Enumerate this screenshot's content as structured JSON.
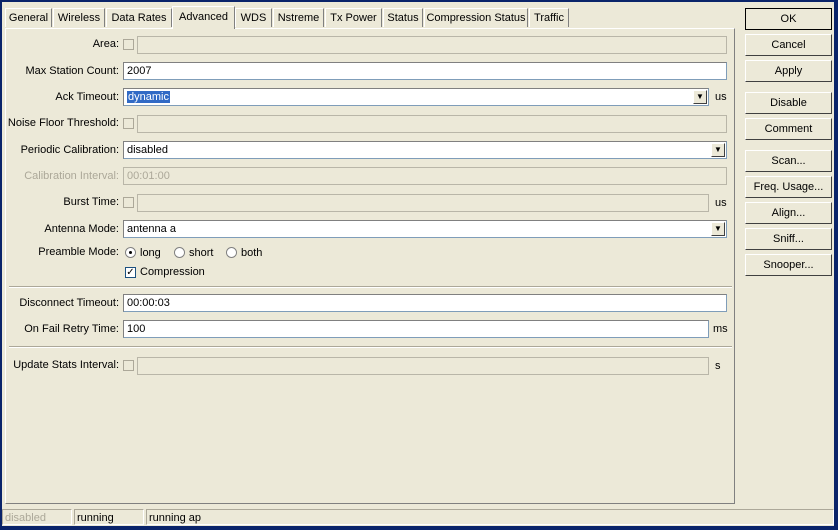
{
  "tabs": [
    "General",
    "Wireless",
    "Data Rates",
    "Advanced",
    "WDS",
    "Nstreme",
    "Tx Power",
    "Status",
    "Compression Status",
    "Traffic"
  ],
  "form": {
    "area": {
      "label": "Area:",
      "value": ""
    },
    "max_station_count": {
      "label": "Max Station Count:",
      "value": "2007"
    },
    "ack_timeout": {
      "label": "Ack Timeout:",
      "value": "dynamic",
      "unit": "us"
    },
    "noise_floor_threshold": {
      "label": "Noise Floor Threshold:",
      "value": ""
    },
    "periodic_calibration": {
      "label": "Periodic Calibration:",
      "value": "disabled"
    },
    "calibration_interval": {
      "label": "Calibration Interval:",
      "value": "00:01:00"
    },
    "burst_time": {
      "label": "Burst Time:",
      "value": "",
      "unit": "us"
    },
    "antenna_mode": {
      "label": "Antenna Mode:",
      "value": "antenna a"
    },
    "preamble_mode": {
      "label": "Preamble Mode:",
      "options": [
        "long",
        "short",
        "both"
      ],
      "selected": "long"
    },
    "compression": {
      "label": "Compression",
      "checked": true
    },
    "disconnect_timeout": {
      "label": "Disconnect Timeout:",
      "value": "00:00:03"
    },
    "on_fail_retry_time": {
      "label": "On Fail Retry Time:",
      "value": "100",
      "unit": "ms"
    },
    "update_stats_interval": {
      "label": "Update Stats Interval:",
      "value": "",
      "unit": "s"
    }
  },
  "buttons": [
    "OK",
    "Cancel",
    "Apply",
    "Disable",
    "Comment",
    "Scan...",
    "Freq. Usage...",
    "Align...",
    "Sniff...",
    "Snooper..."
  ],
  "status": [
    "disabled",
    "running",
    "running ap"
  ]
}
